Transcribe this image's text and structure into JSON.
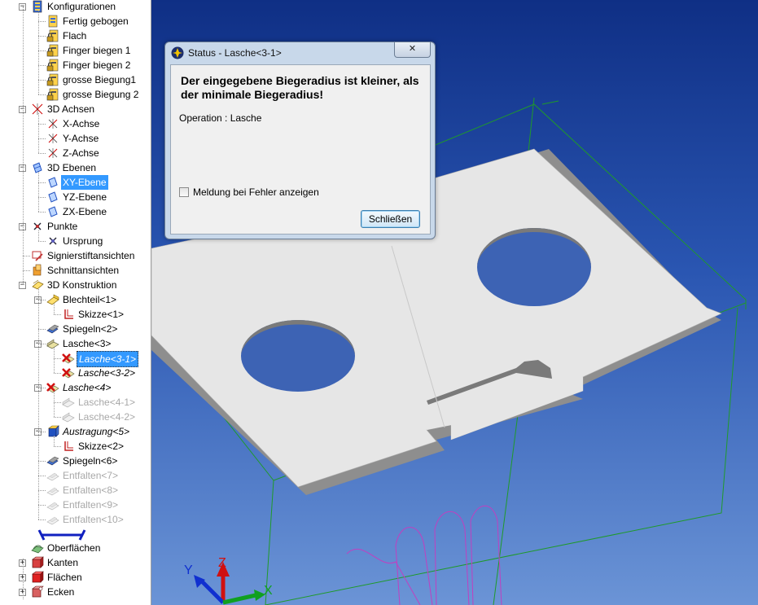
{
  "tree": {
    "items": [
      {
        "label": "Konfigurationen",
        "icon": "config-icon",
        "level": 0,
        "expander": "-",
        "state": "normal"
      },
      {
        "label": "Fertig gebogen",
        "icon": "config-item-icon",
        "level": 1,
        "state": "normal"
      },
      {
        "label": "Flach",
        "icon": "config-locked-icon",
        "level": 1,
        "state": "normal"
      },
      {
        "label": "Finger biegen 1",
        "icon": "config-locked-icon",
        "level": 1,
        "state": "normal"
      },
      {
        "label": "Finger biegen 2",
        "icon": "config-locked-icon",
        "level": 1,
        "state": "normal"
      },
      {
        "label": "grosse Biegung1",
        "icon": "config-locked-icon",
        "level": 1,
        "state": "normal"
      },
      {
        "label": "grosse Biegung 2",
        "icon": "config-locked-icon",
        "level": 1,
        "state": "normal"
      },
      {
        "label": "3D Achsen",
        "icon": "axes-icon",
        "level": 0,
        "expander": "-",
        "state": "normal"
      },
      {
        "label": "X-Achse",
        "icon": "axis-icon",
        "level": 1,
        "state": "normal"
      },
      {
        "label": "Y-Achse",
        "icon": "axis-icon",
        "level": 1,
        "state": "normal"
      },
      {
        "label": "Z-Achse",
        "icon": "axis-icon",
        "level": 1,
        "state": "normal"
      },
      {
        "label": "3D Ebenen",
        "icon": "planes-icon",
        "level": 0,
        "expander": "-",
        "state": "normal"
      },
      {
        "label": "XY-Ebene",
        "icon": "plane-icon",
        "level": 1,
        "state": "selected"
      },
      {
        "label": "YZ-Ebene",
        "icon": "plane-icon",
        "level": 1,
        "state": "normal"
      },
      {
        "label": "ZX-Ebene",
        "icon": "plane-icon",
        "level": 1,
        "state": "normal"
      },
      {
        "label": "Punkte",
        "icon": "points-icon",
        "level": 0,
        "expander": "-",
        "state": "normal"
      },
      {
        "label": "Ursprung",
        "icon": "point-icon",
        "level": 1,
        "state": "normal"
      },
      {
        "label": "Signierstiftansichten",
        "icon": "pen-view-icon",
        "level": 0,
        "state": "normal"
      },
      {
        "label": "Schnittansichten",
        "icon": "section-view-icon",
        "level": 0,
        "state": "normal"
      },
      {
        "label": "3D Konstruktion",
        "icon": "construction-icon",
        "level": 0,
        "expander": "-",
        "state": "normal"
      },
      {
        "label": "Blechteil<1>",
        "icon": "sheetmetal-icon",
        "level": 1,
        "expander": "-",
        "state": "normal"
      },
      {
        "label": "Skizze<1>",
        "icon": "sketch-icon",
        "level": 2,
        "state": "normal"
      },
      {
        "label": "Spiegeln<2>",
        "icon": "mirror-icon",
        "level": 1,
        "state": "normal"
      },
      {
        "label": "Lasche<3>",
        "icon": "flange-icon",
        "level": 1,
        "expander": "-",
        "state": "normal"
      },
      {
        "label": "Lasche<3-1>",
        "icon": "error-flange-icon",
        "level": 2,
        "state": "error-selected"
      },
      {
        "label": "Lasche<3-2>",
        "icon": "error-flange-icon",
        "level": 2,
        "state": "error"
      },
      {
        "label": "Lasche<4>",
        "icon": "error-flange-icon",
        "level": 1,
        "expander": "-",
        "state": "error"
      },
      {
        "label": "Lasche<4-1>",
        "icon": "flange-disabled-icon",
        "level": 2,
        "state": "disabled"
      },
      {
        "label": "Lasche<4-2>",
        "icon": "flange-disabled-icon",
        "level": 2,
        "state": "disabled"
      },
      {
        "label": "Austragung<5>",
        "icon": "extrude-icon",
        "level": 1,
        "expander": "-",
        "state": "italic"
      },
      {
        "label": "Skizze<2>",
        "icon": "sketch-icon",
        "level": 2,
        "state": "normal"
      },
      {
        "label": "Spiegeln<6>",
        "icon": "mirror-icon",
        "level": 1,
        "state": "normal"
      },
      {
        "label": "Entfalten<7>",
        "icon": "unfold-disabled-icon",
        "level": 1,
        "state": "disabled"
      },
      {
        "label": "Entfalten<8>",
        "icon": "unfold-disabled-icon",
        "level": 1,
        "state": "disabled"
      },
      {
        "label": "Entfalten<9>",
        "icon": "unfold-disabled-icon",
        "level": 1,
        "state": "disabled"
      },
      {
        "label": "Entfalten<10>",
        "icon": "unfold-disabled-icon",
        "level": 1,
        "state": "disabled"
      }
    ],
    "bottom_items": [
      {
        "label": "Oberflächen",
        "icon": "surfaces-icon",
        "expander": ""
      },
      {
        "label": "Kanten",
        "icon": "edges-icon",
        "expander": "+"
      },
      {
        "label": "Flächen",
        "icon": "faces-icon",
        "expander": "+"
      },
      {
        "label": "Ecken",
        "icon": "corners-icon",
        "expander": "+"
      }
    ]
  },
  "dialog": {
    "title": "Status  - Lasche<3-1>",
    "close_label": "✕",
    "message": "Der eingegebene Biegeradius ist kleiner, als der minimale Biegeradius!",
    "operation": "Operation : Lasche",
    "checkbox_label": "Meldung bei Fehler anzeigen",
    "checkbox_checked": false,
    "button_label": "Schließen"
  },
  "viewport": {
    "axis_labels": {
      "x": "X",
      "y": "Y",
      "z": "Z"
    },
    "colors": {
      "background_top": "#0f2f85",
      "background_bottom": "#6b94d6",
      "part": "#e4e4e4",
      "construction_lines": "#1f9a2a",
      "sketch": "#c040c0"
    }
  }
}
